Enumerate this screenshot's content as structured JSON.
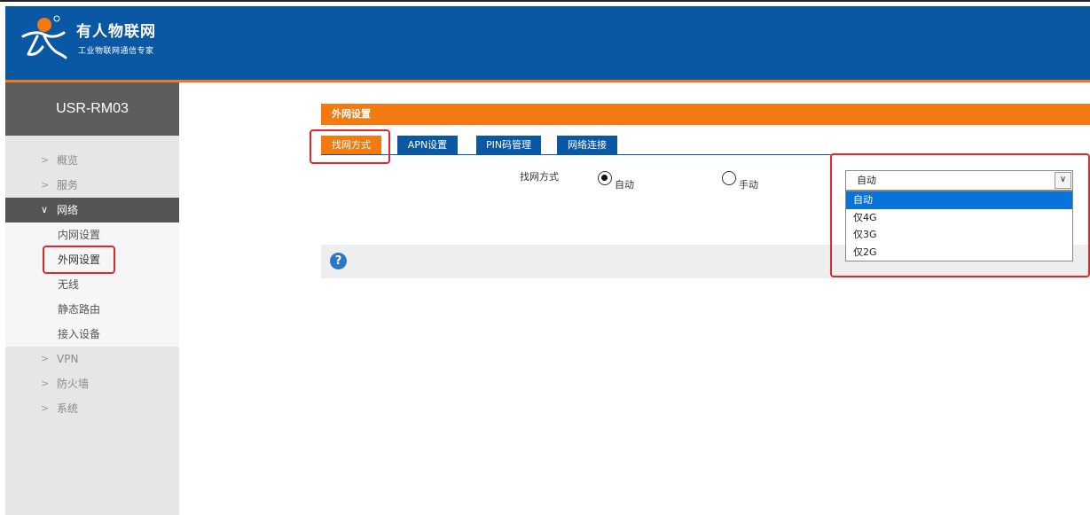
{
  "brand": {
    "name": "有人物联网",
    "tagline": "工业物联网通信专家"
  },
  "sidebar": {
    "device_title": "USR-RM03",
    "items": [
      {
        "label": "概览",
        "chevron": ">"
      },
      {
        "label": "服务",
        "chevron": ">"
      },
      {
        "label": "网络",
        "chevron": "∨",
        "expanded": true,
        "children": [
          {
            "label": "内网设置"
          },
          {
            "label": "外网设置",
            "active": true
          },
          {
            "label": "无线"
          },
          {
            "label": "静态路由"
          },
          {
            "label": "接入设备"
          }
        ]
      },
      {
        "label": "VPN",
        "chevron": ">"
      },
      {
        "label": "防火墙",
        "chevron": ">"
      },
      {
        "label": "系统",
        "chevron": ">"
      }
    ]
  },
  "main": {
    "panel_title": "外网设置",
    "tabs": [
      {
        "label": "找网方式",
        "active": true
      },
      {
        "label": "APN设置"
      },
      {
        "label": "PIN码管理"
      },
      {
        "label": "网络连接"
      }
    ],
    "field_label": "找网方式",
    "radio_auto": {
      "label": "自动",
      "checked": true
    },
    "radio_manual": {
      "label": "手动",
      "checked": false
    },
    "help_icon": "?"
  },
  "network_select": {
    "value": "自动",
    "arrow": "∨",
    "options": [
      "自动",
      "仅4G",
      "仅3G",
      "仅2G"
    ],
    "selected_index": 0
  },
  "colors": {
    "header_blue": "#0a57a4",
    "accent_orange": "#f37a10",
    "highlight_red": "#e3262b",
    "option_selected": "#0a73d9"
  }
}
